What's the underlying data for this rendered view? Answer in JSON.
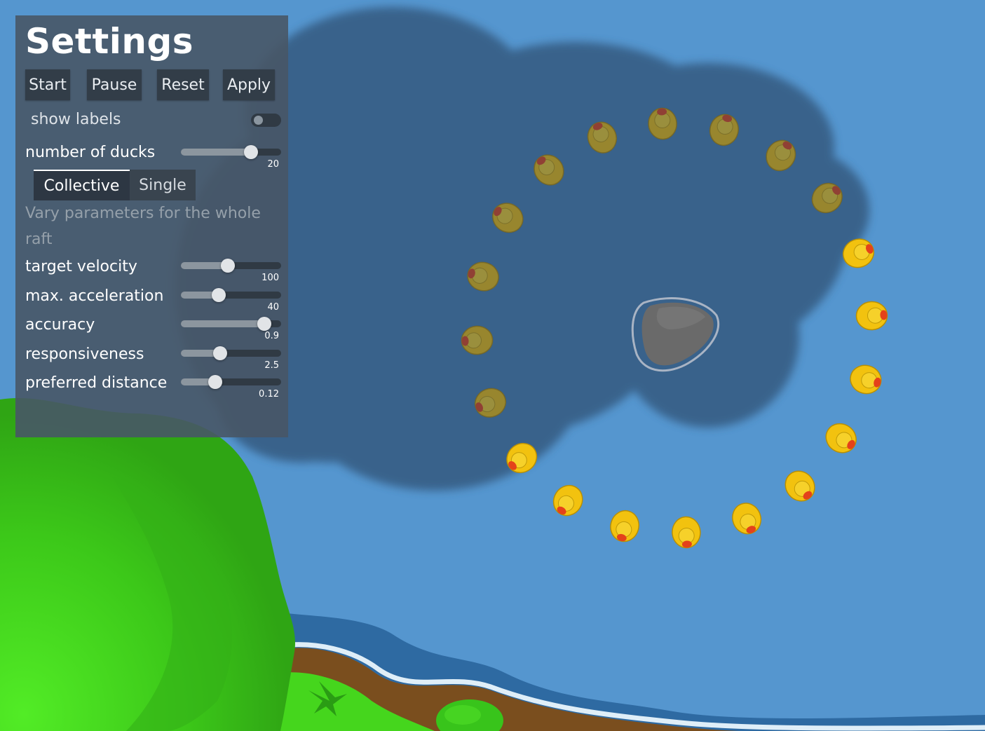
{
  "settings": {
    "title": "Settings",
    "buttons": {
      "start": "Start",
      "pause": "Pause",
      "reset": "Reset",
      "apply": "Apply"
    },
    "show_labels": {
      "label": "show labels",
      "enabled": false
    },
    "number_of_ducks": {
      "label": "number of ducks",
      "value": "20",
      "fraction": 0.7
    },
    "tabs": {
      "collective": "Collective",
      "single": "Single",
      "active": "collective"
    },
    "description": "Vary parameters for the whole raft",
    "params": [
      {
        "label": "target velocity",
        "value": "100",
        "fraction": 0.47
      },
      {
        "label": "max. acceleration",
        "value": "40",
        "fraction": 0.38
      },
      {
        "label": "accuracy",
        "value": "0.9",
        "fraction": 0.83
      },
      {
        "label": "responsiveness",
        "value": "2.5",
        "fraction": 0.39
      },
      {
        "label": "preferred distance",
        "value": "0.12",
        "fraction": 0.34
      }
    ]
  },
  "scene": {
    "water_color": "#5596cf",
    "shadow_color": "#386088",
    "grass_color": "#3ecc1c",
    "bank_color": "#7a4e1e",
    "rock_color": "#6f6f6f",
    "duck_color": "#f2c20f",
    "duck_count": 20
  }
}
